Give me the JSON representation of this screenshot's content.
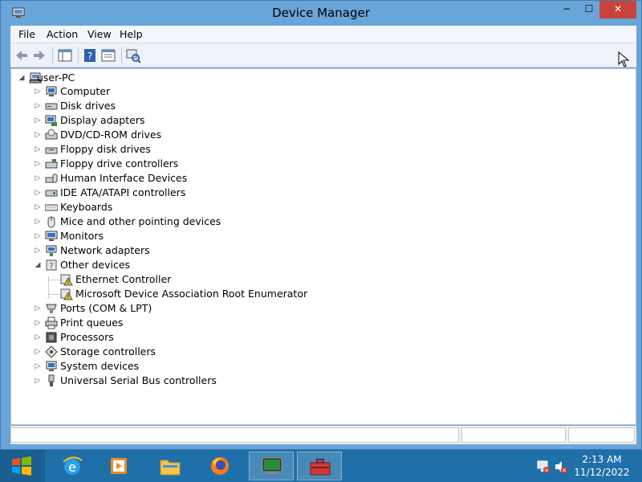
{
  "window": {
    "title": "Device Manager",
    "minimize_glyph": "−",
    "maximize_glyph": "☐",
    "close_glyph": "✕"
  },
  "menu": {
    "items": [
      "File",
      "Action",
      "View",
      "Help"
    ]
  },
  "toolbar": {
    "buttons": [
      "back-icon",
      "forward-icon",
      "show-hide-console-tree-icon",
      "help-icon",
      "properties-icon",
      "scan-hardware-icon"
    ]
  },
  "tree": {
    "root": "user-PC",
    "categories": [
      "Computer",
      "Disk drives",
      "Display adapters",
      "DVD/CD-ROM drives",
      "Floppy disk drives",
      "Floppy drive controllers",
      "Human Interface Devices",
      "IDE ATA/ATAPI controllers",
      "Keyboards",
      "Mice and other pointing devices",
      "Monitors",
      "Network adapters",
      "Other devices",
      "Ports (COM & LPT)",
      "Print queues",
      "Processors",
      "Storage controllers",
      "System devices",
      "Universal Serial Bus controllers"
    ],
    "other_devices_children": [
      "Ethernet Controller",
      "Microsoft Device Association Root Enumerator"
    ]
  },
  "taskbar": {
    "apps": [
      "internet-explorer-icon",
      "media-player-icon",
      "file-explorer-icon",
      "firefox-icon",
      "device-manager-icon",
      "toolbox-icon"
    ],
    "time": "2:13 AM",
    "date": "11/12/2022"
  },
  "colors": {
    "title_bar": "#6aa5d8",
    "close_button": "#c7443b",
    "taskbar": "#1f6fa8",
    "warning": "#f0c020"
  }
}
